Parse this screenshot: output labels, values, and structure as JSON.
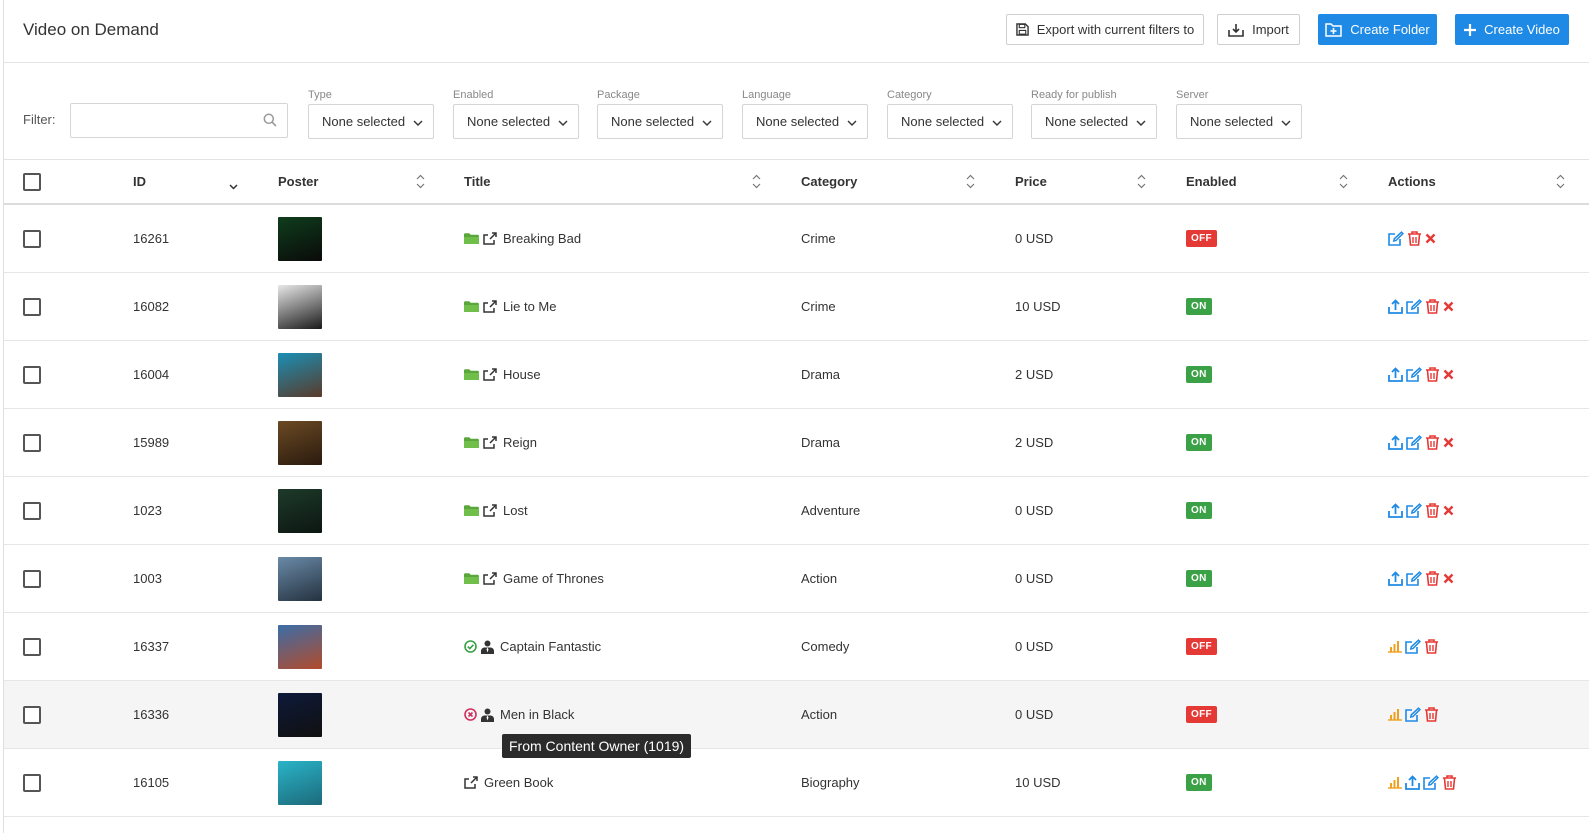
{
  "header": {
    "title": "Video on Demand",
    "export_label": "Export with current filters to",
    "import_label": "Import",
    "create_folder_label": "Create Folder",
    "create_video_label": "Create Video"
  },
  "filters": {
    "filter_label": "Filter:",
    "search_value": "",
    "groups": [
      {
        "label": "Type",
        "value": "None selected"
      },
      {
        "label": "Enabled",
        "value": "None selected"
      },
      {
        "label": "Package",
        "value": "None selected"
      },
      {
        "label": "Language",
        "value": "None selected"
      },
      {
        "label": "Category",
        "value": "None selected"
      },
      {
        "label": "Ready for publish",
        "value": "None selected"
      },
      {
        "label": "Server",
        "value": "None selected"
      }
    ]
  },
  "columns": {
    "id": "ID",
    "poster": "Poster",
    "title": "Title",
    "category": "Category",
    "price": "Price",
    "enabled": "Enabled",
    "actions": "Actions"
  },
  "rows": [
    {
      "id": "16261",
      "title": "Breaking Bad",
      "category": "Crime",
      "price": "0 USD",
      "enabled": "OFF",
      "poster_colors": [
        "#0f3d1c",
        "#0a0a0a"
      ]
    },
    {
      "id": "16082",
      "title": "Lie to Me",
      "category": "Crime",
      "price": "10 USD",
      "enabled": "ON",
      "poster_colors": [
        "#e8e8e8",
        "#1a1a1a"
      ]
    },
    {
      "id": "16004",
      "title": "House",
      "category": "Drama",
      "price": "2 USD",
      "enabled": "ON",
      "poster_colors": [
        "#1a8fb5",
        "#5a3a2a"
      ]
    },
    {
      "id": "15989",
      "title": "Reign",
      "category": "Drama",
      "price": "2 USD",
      "enabled": "ON",
      "poster_colors": [
        "#6b4a24",
        "#2a1a0e"
      ]
    },
    {
      "id": "1023",
      "title": "Lost",
      "category": "Adventure",
      "price": "0 USD",
      "enabled": "ON",
      "poster_colors": [
        "#1e3a2a",
        "#0c1612"
      ]
    },
    {
      "id": "1003",
      "title": "Game of Thrones",
      "category": "Action",
      "price": "0 USD",
      "enabled": "ON",
      "poster_colors": [
        "#6a8aa8",
        "#24323f"
      ]
    },
    {
      "id": "16337",
      "title": "Captain Fantastic",
      "category": "Comedy",
      "price": "0 USD",
      "enabled": "OFF",
      "poster_colors": [
        "#3b6ea8",
        "#b34a2a"
      ]
    },
    {
      "id": "16336",
      "title": "Men in Black",
      "category": "Action",
      "price": "0 USD",
      "enabled": "OFF",
      "poster_colors": [
        "#0e1a3a",
        "#101010"
      ]
    },
    {
      "id": "16105",
      "title": "Green Book",
      "category": "Biography",
      "price": "10 USD",
      "enabled": "ON",
      "poster_colors": [
        "#2ab4c8",
        "#1c6a7a"
      ]
    }
  ],
  "tooltip": "From Content Owner (1019)",
  "colors": {
    "primary": "#1e8ae6",
    "folder": "#5aa63c",
    "on": "#3aa146",
    "off": "#e53935",
    "delete": "#e53935",
    "stats": "#f0a020"
  },
  "icons": {
    "folder": "folder-icon",
    "share": "share-icon",
    "check": "check-circle-icon",
    "unpublished": "x-circle-icon",
    "owner": "owner-icon",
    "upload": "upload-icon",
    "edit": "edit-icon",
    "trash": "trash-icon",
    "remove": "remove-icon",
    "stats": "bar-chart-icon"
  }
}
